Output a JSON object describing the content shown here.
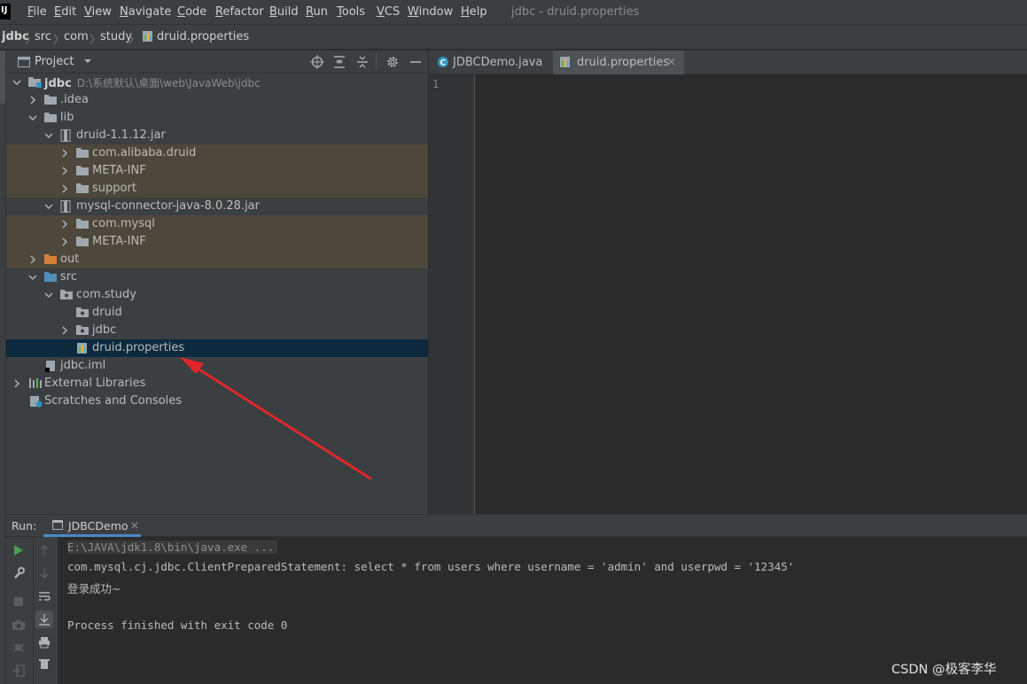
{
  "menu": [
    "File",
    "Edit",
    "View",
    "Navigate",
    "Code",
    "Refactor",
    "Build",
    "Run",
    "Tools",
    "VCS",
    "Window",
    "Help"
  ],
  "window_title": "jdbc - druid.properties",
  "breadcrumbs": [
    "jdbc",
    "src",
    "com",
    "study",
    "druid.properties"
  ],
  "project_panel": {
    "title": "Project",
    "tree": [
      {
        "label": "jdbc",
        "path": "D:\\系统默认\\桌面\\web\\JavaWeb\\jdbc",
        "bold": true,
        "depth": 0,
        "expanded": true,
        "icon": "module-folder"
      },
      {
        "label": ".idea",
        "depth": 1,
        "expanded": false,
        "icon": "folder"
      },
      {
        "label": "lib",
        "depth": 1,
        "expanded": true,
        "icon": "folder"
      },
      {
        "label": "druid-1.1.12.jar",
        "depth": 2,
        "expanded": true,
        "icon": "jar"
      },
      {
        "label": "com.alibaba.druid",
        "depth": 3,
        "expanded": false,
        "icon": "folder",
        "highlight": true
      },
      {
        "label": "META-INF",
        "depth": 3,
        "expanded": false,
        "icon": "folder",
        "highlight": true
      },
      {
        "label": "support",
        "depth": 3,
        "expanded": false,
        "icon": "folder",
        "highlight": true
      },
      {
        "label": "mysql-connector-java-8.0.28.jar",
        "depth": 2,
        "expanded": true,
        "icon": "jar"
      },
      {
        "label": "com.mysql",
        "depth": 3,
        "expanded": false,
        "icon": "folder",
        "highlight": true
      },
      {
        "label": "META-INF",
        "depth": 3,
        "expanded": false,
        "icon": "folder",
        "highlight": true
      },
      {
        "label": "out",
        "depth": 1,
        "expanded": false,
        "icon": "folder-orange",
        "highlight": true
      },
      {
        "label": "src",
        "depth": 1,
        "expanded": true,
        "icon": "folder-blue"
      },
      {
        "label": "com.study",
        "depth": 2,
        "expanded": true,
        "icon": "package"
      },
      {
        "label": "druid",
        "depth": 3,
        "icon": "package"
      },
      {
        "label": "jdbc",
        "depth": 3,
        "expanded": false,
        "icon": "package"
      },
      {
        "label": "druid.properties",
        "depth": 3,
        "icon": "properties",
        "selected": true
      },
      {
        "label": "jdbc.iml",
        "depth": 1,
        "icon": "iml"
      },
      {
        "label": "External Libraries",
        "depth": 0,
        "expanded": false,
        "icon": "libraries"
      },
      {
        "label": "Scratches and Consoles",
        "depth": 0,
        "icon": "scratches"
      }
    ]
  },
  "editor_tabs": [
    {
      "label": "JDBCDemo.java",
      "icon": "java-class",
      "active": false
    },
    {
      "label": "druid.properties",
      "icon": "properties",
      "active": true
    }
  ],
  "editor": {
    "line_numbers": [
      "1"
    ]
  },
  "run_panel": {
    "label": "Run:",
    "tab": "JDBCDemo",
    "console": [
      "E:\\JAVA\\jdk1.8\\bin\\java.exe ...",
      "com.mysql.cj.jdbc.ClientPreparedStatement: select * from users where username = 'admin' and userpwd = '12345'",
      "登录成功~",
      "",
      "Process finished with exit code 0"
    ]
  },
  "watermark": "CSDN @极客李华",
  "colors": {
    "panel_bg": "#3c3f41",
    "editor_bg": "#2b2b2b",
    "selection": "#0d293e",
    "library_highlight": "#4d483b",
    "arrow_annotation": "#e0262a",
    "run_green": "#499c54"
  }
}
